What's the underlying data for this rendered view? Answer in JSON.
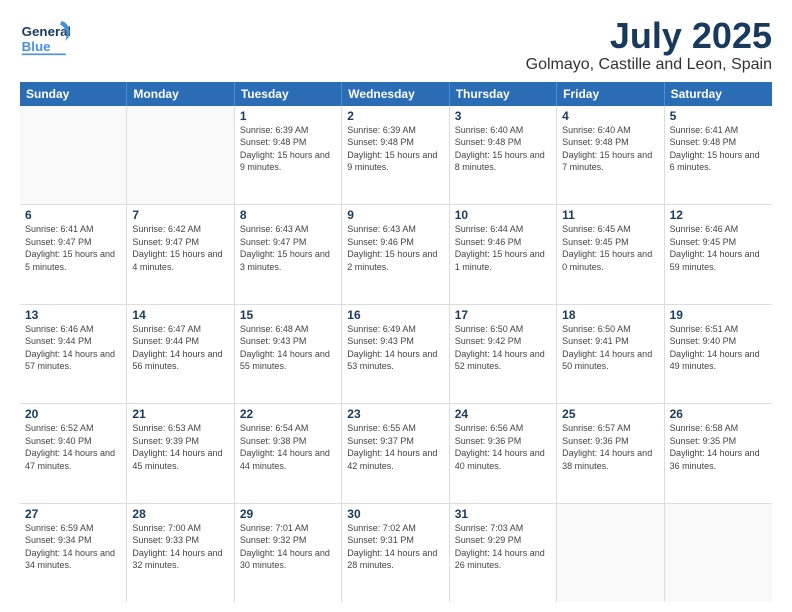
{
  "header": {
    "logo_general": "General",
    "logo_blue": "Blue",
    "title": "July 2025",
    "subtitle": "Golmayo, Castille and Leon, Spain"
  },
  "calendar": {
    "headers": [
      "Sunday",
      "Monday",
      "Tuesday",
      "Wednesday",
      "Thursday",
      "Friday",
      "Saturday"
    ],
    "rows": [
      [
        {
          "day": "",
          "empty": true
        },
        {
          "day": "",
          "empty": true
        },
        {
          "day": "1",
          "sunrise": "Sunrise: 6:39 AM",
          "sunset": "Sunset: 9:48 PM",
          "daylight": "Daylight: 15 hours and 9 minutes."
        },
        {
          "day": "2",
          "sunrise": "Sunrise: 6:39 AM",
          "sunset": "Sunset: 9:48 PM",
          "daylight": "Daylight: 15 hours and 9 minutes."
        },
        {
          "day": "3",
          "sunrise": "Sunrise: 6:40 AM",
          "sunset": "Sunset: 9:48 PM",
          "daylight": "Daylight: 15 hours and 8 minutes."
        },
        {
          "day": "4",
          "sunrise": "Sunrise: 6:40 AM",
          "sunset": "Sunset: 9:48 PM",
          "daylight": "Daylight: 15 hours and 7 minutes."
        },
        {
          "day": "5",
          "sunrise": "Sunrise: 6:41 AM",
          "sunset": "Sunset: 9:48 PM",
          "daylight": "Daylight: 15 hours and 6 minutes."
        }
      ],
      [
        {
          "day": "6",
          "sunrise": "Sunrise: 6:41 AM",
          "sunset": "Sunset: 9:47 PM",
          "daylight": "Daylight: 15 hours and 5 minutes."
        },
        {
          "day": "7",
          "sunrise": "Sunrise: 6:42 AM",
          "sunset": "Sunset: 9:47 PM",
          "daylight": "Daylight: 15 hours and 4 minutes."
        },
        {
          "day": "8",
          "sunrise": "Sunrise: 6:43 AM",
          "sunset": "Sunset: 9:47 PM",
          "daylight": "Daylight: 15 hours and 3 minutes."
        },
        {
          "day": "9",
          "sunrise": "Sunrise: 6:43 AM",
          "sunset": "Sunset: 9:46 PM",
          "daylight": "Daylight: 15 hours and 2 minutes."
        },
        {
          "day": "10",
          "sunrise": "Sunrise: 6:44 AM",
          "sunset": "Sunset: 9:46 PM",
          "daylight": "Daylight: 15 hours and 1 minute."
        },
        {
          "day": "11",
          "sunrise": "Sunrise: 6:45 AM",
          "sunset": "Sunset: 9:45 PM",
          "daylight": "Daylight: 15 hours and 0 minutes."
        },
        {
          "day": "12",
          "sunrise": "Sunrise: 6:46 AM",
          "sunset": "Sunset: 9:45 PM",
          "daylight": "Daylight: 14 hours and 59 minutes."
        }
      ],
      [
        {
          "day": "13",
          "sunrise": "Sunrise: 6:46 AM",
          "sunset": "Sunset: 9:44 PM",
          "daylight": "Daylight: 14 hours and 57 minutes."
        },
        {
          "day": "14",
          "sunrise": "Sunrise: 6:47 AM",
          "sunset": "Sunset: 9:44 PM",
          "daylight": "Daylight: 14 hours and 56 minutes."
        },
        {
          "day": "15",
          "sunrise": "Sunrise: 6:48 AM",
          "sunset": "Sunset: 9:43 PM",
          "daylight": "Daylight: 14 hours and 55 minutes."
        },
        {
          "day": "16",
          "sunrise": "Sunrise: 6:49 AM",
          "sunset": "Sunset: 9:43 PM",
          "daylight": "Daylight: 14 hours and 53 minutes."
        },
        {
          "day": "17",
          "sunrise": "Sunrise: 6:50 AM",
          "sunset": "Sunset: 9:42 PM",
          "daylight": "Daylight: 14 hours and 52 minutes."
        },
        {
          "day": "18",
          "sunrise": "Sunrise: 6:50 AM",
          "sunset": "Sunset: 9:41 PM",
          "daylight": "Daylight: 14 hours and 50 minutes."
        },
        {
          "day": "19",
          "sunrise": "Sunrise: 6:51 AM",
          "sunset": "Sunset: 9:40 PM",
          "daylight": "Daylight: 14 hours and 49 minutes."
        }
      ],
      [
        {
          "day": "20",
          "sunrise": "Sunrise: 6:52 AM",
          "sunset": "Sunset: 9:40 PM",
          "daylight": "Daylight: 14 hours and 47 minutes."
        },
        {
          "day": "21",
          "sunrise": "Sunrise: 6:53 AM",
          "sunset": "Sunset: 9:39 PM",
          "daylight": "Daylight: 14 hours and 45 minutes."
        },
        {
          "day": "22",
          "sunrise": "Sunrise: 6:54 AM",
          "sunset": "Sunset: 9:38 PM",
          "daylight": "Daylight: 14 hours and 44 minutes."
        },
        {
          "day": "23",
          "sunrise": "Sunrise: 6:55 AM",
          "sunset": "Sunset: 9:37 PM",
          "daylight": "Daylight: 14 hours and 42 minutes."
        },
        {
          "day": "24",
          "sunrise": "Sunrise: 6:56 AM",
          "sunset": "Sunset: 9:36 PM",
          "daylight": "Daylight: 14 hours and 40 minutes."
        },
        {
          "day": "25",
          "sunrise": "Sunrise: 6:57 AM",
          "sunset": "Sunset: 9:36 PM",
          "daylight": "Daylight: 14 hours and 38 minutes."
        },
        {
          "day": "26",
          "sunrise": "Sunrise: 6:58 AM",
          "sunset": "Sunset: 9:35 PM",
          "daylight": "Daylight: 14 hours and 36 minutes."
        }
      ],
      [
        {
          "day": "27",
          "sunrise": "Sunrise: 6:59 AM",
          "sunset": "Sunset: 9:34 PM",
          "daylight": "Daylight: 14 hours and 34 minutes."
        },
        {
          "day": "28",
          "sunrise": "Sunrise: 7:00 AM",
          "sunset": "Sunset: 9:33 PM",
          "daylight": "Daylight: 14 hours and 32 minutes."
        },
        {
          "day": "29",
          "sunrise": "Sunrise: 7:01 AM",
          "sunset": "Sunset: 9:32 PM",
          "daylight": "Daylight: 14 hours and 30 minutes."
        },
        {
          "day": "30",
          "sunrise": "Sunrise: 7:02 AM",
          "sunset": "Sunset: 9:31 PM",
          "daylight": "Daylight: 14 hours and 28 minutes."
        },
        {
          "day": "31",
          "sunrise": "Sunrise: 7:03 AM",
          "sunset": "Sunset: 9:29 PM",
          "daylight": "Daylight: 14 hours and 26 minutes."
        },
        {
          "day": "",
          "empty": true
        },
        {
          "day": "",
          "empty": true
        }
      ]
    ]
  }
}
